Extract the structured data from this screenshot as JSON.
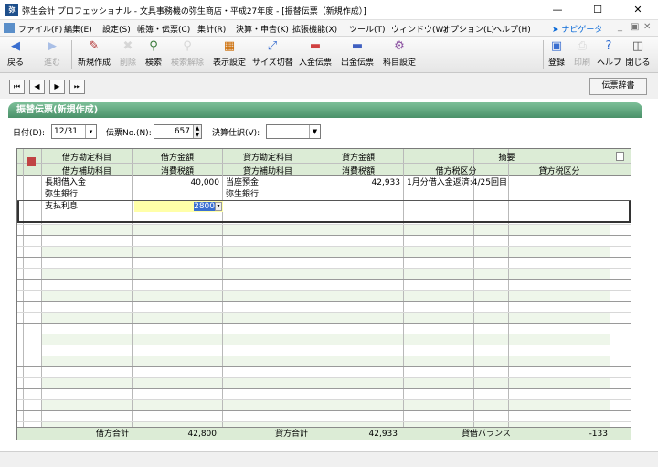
{
  "window": {
    "title": "弥生会計 プロフェッショナル - 文具事務機の弥生商店・平成27年度 - [振替伝票（新規作成）]",
    "logo_text": "弥"
  },
  "menu": {
    "items": [
      "ファイル(F)",
      "編集(E)",
      "設定(S)",
      "帳簿・伝票(C)",
      "集計(R)",
      "決算・申告(K)",
      "拡張機能(X)",
      "ツール(T)",
      "ウィンドウ(W)",
      "オプション(L)",
      "ヘルプ(H)"
    ],
    "navigator": "ナビゲータ"
  },
  "toolbar": {
    "back": "戻る",
    "forward": "進む",
    "new": "新規作成",
    "delete": "削除",
    "search": "検索",
    "cond_delete": "検索解除",
    "display": "表示設定",
    "size": "サイズ切替",
    "deposit": "入金伝票",
    "payment": "出金伝票",
    "accounts": "科目設定",
    "register": "登録",
    "print": "印刷",
    "help": "ヘルプ",
    "close": "閉じる"
  },
  "nav": {
    "dict_button": "伝票辞書"
  },
  "form": {
    "header": "振替伝票(新規作成)",
    "date_label": "日付(D):",
    "date_value": "12/31",
    "voucher_no_label": "伝票No.(N):",
    "voucher_no_value": "657",
    "closing_label": "決算仕訳(V):",
    "closing_value": ""
  },
  "grid": {
    "headers_top": [
      "借方勘定科目",
      "借方金額",
      "貸方勘定科目",
      "貸方金額",
      "摘要"
    ],
    "headers_bottom": [
      "借方補助科目",
      "消費税額",
      "貸方補助科目",
      "消費税額",
      "借方税区分",
      "貸方税区分"
    ],
    "rows": [
      {
        "debit_account": "長期借入金",
        "debit_amount": "40,000",
        "credit_account": "当座預金",
        "credit_amount": "42,933",
        "memo": "1月分借入金返済:4/25回目"
      },
      {
        "debit_account": "弥生銀行",
        "credit_account": "弥生銀行"
      },
      {
        "debit_account": "支払利息",
        "debit_amount": "2800"
      }
    ],
    "totals": {
      "debit_label": "借方合計",
      "debit_value": "42,800",
      "credit_label": "貸方合計",
      "credit_value": "42,933",
      "balance_label": "貸借バランス",
      "balance_value": "-133"
    }
  },
  "colors": {
    "header_green": "#4a9169",
    "grid_header": "#dcecd6",
    "active_input": "#ffffa8"
  }
}
